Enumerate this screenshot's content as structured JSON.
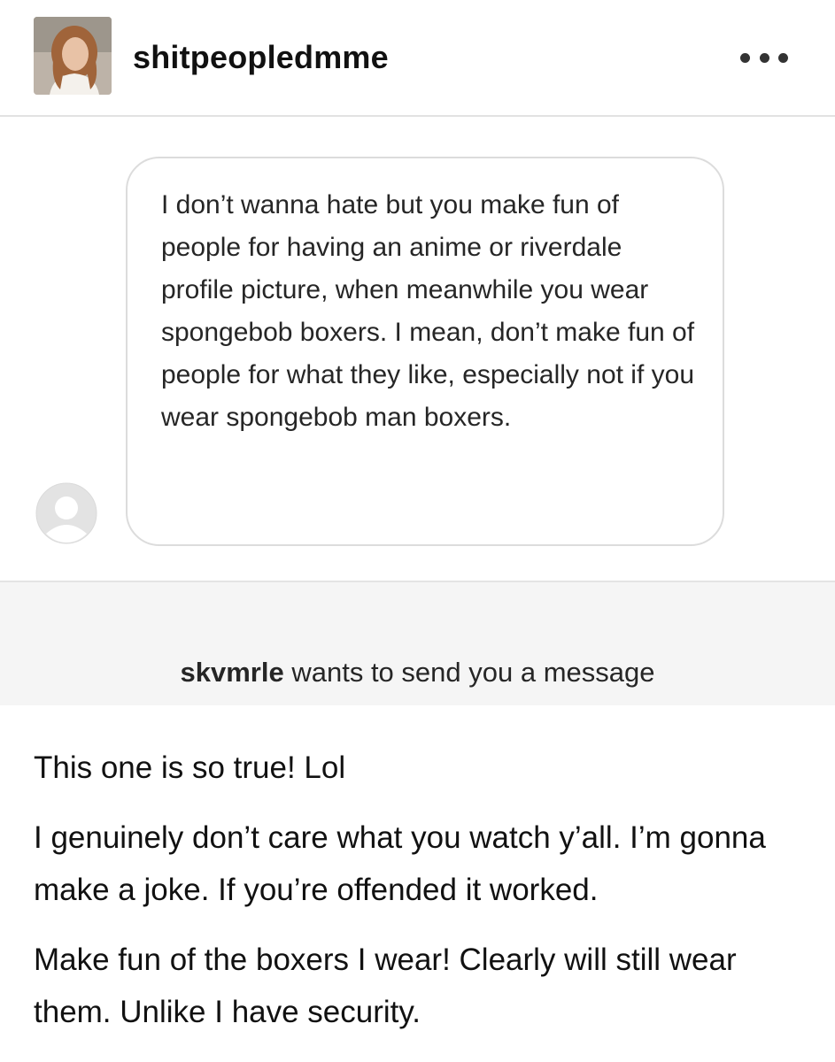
{
  "header": {
    "username": "shitpeopledmme",
    "avatar_icon": "profile-photo",
    "more_icon": "more-options-icon"
  },
  "message": {
    "sender_avatar_icon": "default-user-avatar-icon",
    "text": "I don’t wanna hate but you make fun of people for having an anime or riverdale profile picture, when meanwhile you wear spongebob boxers. I mean, don’t make fun of people for what they like, especially not if you wear spongebob man boxers."
  },
  "request": {
    "username": "skvmrle",
    "text": " wants to send you a message"
  },
  "caption": {
    "paragraphs": [
      "This one is so true! Lol",
      "I genuinely don’t care what you watch y’all. I’m gonna make a joke. If you’re offended it worked.",
      "Make fun of the boxers I wear! Clearly will still wear them. Unlike I have security."
    ]
  },
  "colors": {
    "background": "#ffffff",
    "banner_background": "#f5f5f5",
    "bubble_border": "#dcdcdc",
    "text": "#262626"
  }
}
